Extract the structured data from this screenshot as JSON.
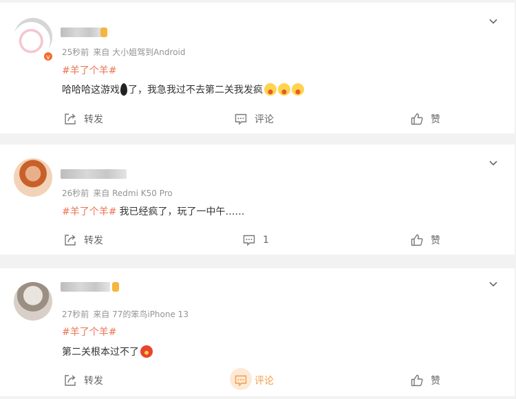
{
  "posts": [
    {
      "meta": {
        "time": "25秒前",
        "source": "来自 大小姐驾到Android"
      },
      "tag": "#羊了个羊#",
      "text_a": "哈哈哈这游戏",
      "text_b": "了，我急我过不去第二关我发疯",
      "verified_badge": "v",
      "actions": {
        "repost": "转发",
        "comment": "评论",
        "like": "赞"
      }
    },
    {
      "meta": {
        "time": "26秒前",
        "source": "来自 Redmi K50 Pro"
      },
      "tag": "#羊了个羊#",
      "text": "我已经疯了，玩了一中午……",
      "actions": {
        "repost": "转发",
        "comment": "1",
        "like": "赞"
      }
    },
    {
      "meta": {
        "time": "27秒前",
        "source": "来自 77的笨鸟iPhone 13"
      },
      "tag": "#羊了个羊#",
      "text": "第二关根本过不了",
      "actions": {
        "repost": "转发",
        "comment": "评论",
        "like": "赞"
      }
    }
  ],
  "colors": {
    "accent": "#eb7350",
    "meta": "#939393",
    "text": "#333333",
    "comment_active": "#f29c48"
  }
}
